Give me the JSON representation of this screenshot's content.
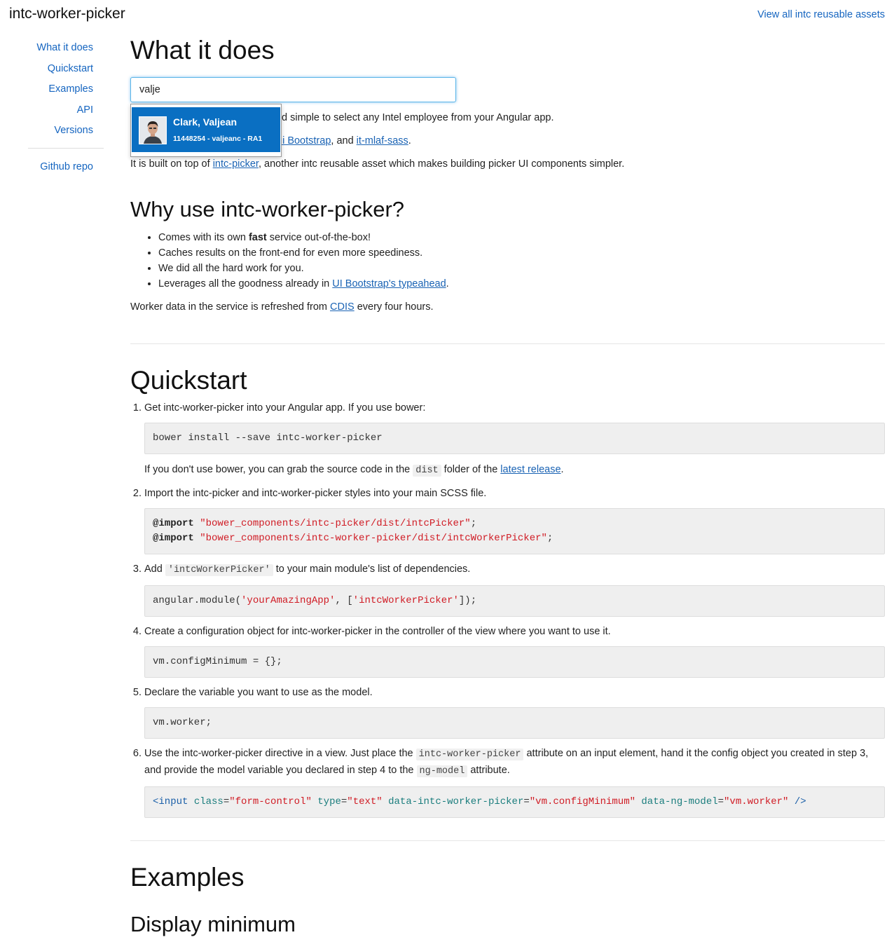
{
  "header": {
    "title": "intc-worker-picker",
    "assets_link": "View all intc reusable assets"
  },
  "sidenav": {
    "items": [
      "What it does",
      "Quickstart",
      "Examples",
      "API",
      "Versions"
    ],
    "repo": "Github repo"
  },
  "what": {
    "heading": "What it does",
    "search": {
      "value": "valje",
      "placeholder": ""
    },
    "dropdown": {
      "name": "Clark, Valjean",
      "sub": "11448254 - valjeanc - RA1"
    },
    "line1_text": "d simple to select any Intel employee from your Angular app.",
    "line2_link1": "ui Bootstrap",
    "line2_mid": ", and ",
    "line2_link2": "it-mlaf-sass",
    "line2_end": ".",
    "line3_pre": "It is built on top of ",
    "line3_link": "intc-picker",
    "line3_post": ", another intc reusable asset which makes building picker UI components simpler."
  },
  "why": {
    "heading": "Why use intc-worker-picker?",
    "b1_pre": "Comes with its own ",
    "b1_bold": "fast",
    "b1_post": " service out-of-the-box!",
    "b2": "Caches results on the front-end for even more speediness.",
    "b3": "We did all the hard work for you.",
    "b4_pre": "Leverages all the goodness already in ",
    "b4_link": "UI Bootstrap's typeahead",
    "b4_post": ".",
    "refresh_pre": "Worker data in the service is refreshed from ",
    "refresh_link": "CDIS",
    "refresh_post": " every four hours."
  },
  "quickstart": {
    "heading": "Quickstart",
    "s1": "Get intc-worker-picker into your Angular app. If you use bower:",
    "s1_code": "bower install --save intc-worker-picker",
    "s1_note_pre": "If you don't use bower, you can grab the source code in the ",
    "s1_note_code": "dist",
    "s1_note_mid": " folder of the ",
    "s1_note_link": "latest release",
    "s1_note_end": ".",
    "s2": "Import the intc-picker and intc-worker-picker styles into your main SCSS file.",
    "s2_kw": "@import",
    "s2_str1": "\"bower_components/intc-picker/dist/intcPicker\"",
    "s2_str2": "\"bower_components/intc-worker-picker/dist/intcWorkerPicker\"",
    "semi": ";",
    "s3_pre": "Add ",
    "s3_code": "'intcWorkerPicker'",
    "s3_post": " to your main module's list of dependencies.",
    "s3_c1": "angular.module(",
    "s3_c2": "'yourAmazingApp'",
    "s3_c3": ", [",
    "s3_c4": "'intcWorkerPicker'",
    "s3_c5": "]);",
    "s4": "Create a configuration object for intc-worker-picker in the controller of the view where you want to use it.",
    "s4_code": "vm.configMinimum = {};",
    "s5": "Declare the variable you want to use as the model.",
    "s5_code": "vm.worker;",
    "s6_pre": "Use the intc-worker-picker directive in a view. Just place the ",
    "s6_code1": "intc-worker-picker",
    "s6_mid": " attribute on an input element, hand it the config object you created in step 3, and provide the model variable you declared in step 4 to the ",
    "s6_code2": "ng-model",
    "s6_end": " attribute.",
    "s6_tag_open": "<input",
    "s6_a1": "class",
    "s6_v1": "\"form-control\"",
    "s6_a2": "type",
    "s6_v2": "\"text\"",
    "s6_a3": "data-intc-worker-picker",
    "s6_v3": "\"vm.configMinimum\"",
    "s6_a4": "data-ng-model",
    "s6_v4": "\"vm.worker\"",
    "s6_close": "/>",
    "eq": "="
  },
  "examples": {
    "heading": "Examples",
    "sub": "Display minimum"
  }
}
